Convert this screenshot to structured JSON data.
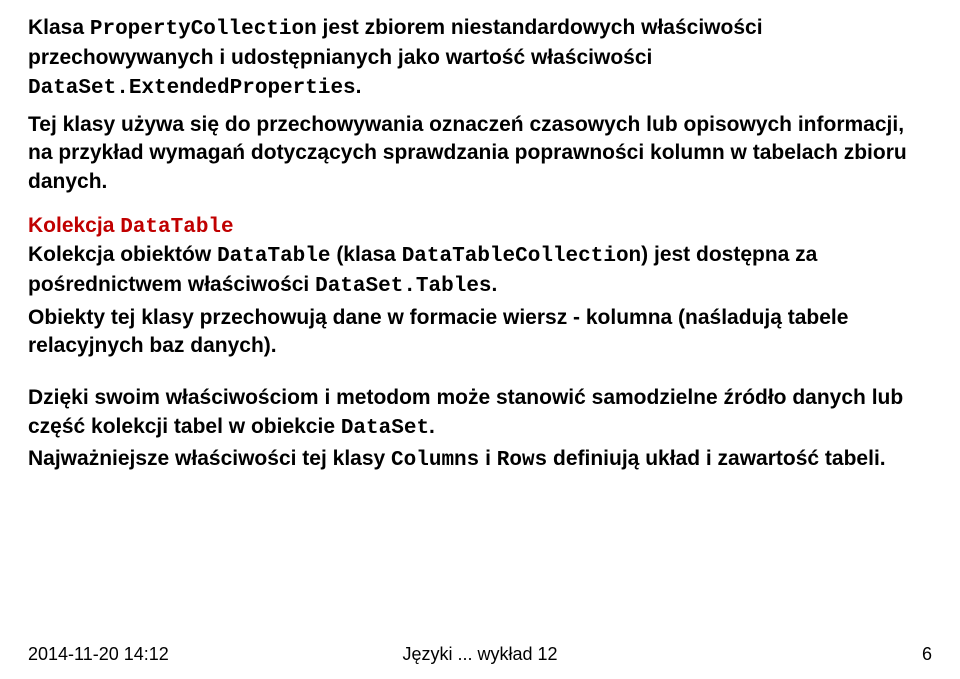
{
  "para1": {
    "pre1": "Klasa ",
    "code1": "PropertyCollection",
    "post1": " jest zbiorem niestandardowych właściwości przechowywanych i udostępnianych jako wartość właściwości ",
    "code2": "DataSet.ExtendedProperties",
    "post2": "."
  },
  "para2": "Tej klasy używa się do przechowywania oznaczeń czasowych lub opisowych informacji, na przykład wymagań dotyczących sprawdzania poprawności kolumn w tabelach zbioru danych.",
  "heading": {
    "pre": "Kolekcja ",
    "code": "DataTable"
  },
  "para3": {
    "pre1": "Kolekcja obiektów ",
    "code1": "DataTable",
    "mid1": " (klasa ",
    "code2": "DataTableCollection",
    "mid2": ") jest dostępna za pośrednictwem właściwości ",
    "code3": "DataSet.Tables",
    "post": "."
  },
  "para4": "Obiekty tej klasy przechowują dane w formacie wiersz - kolumna (naśladują tabele relacyjnych baz danych).",
  "para5": {
    "pre": "Dzięki swoim właściwościom i metodom może stanowić samodzielne źródło danych lub część kolekcji tabel w obiekcie ",
    "code": "DataSet",
    "post": "."
  },
  "para6": {
    "pre": "Najważniejsze właściwości tej klasy ",
    "code1": "Columns",
    "mid": " i ",
    "code2": "Rows",
    "post": "  definiują układ i zawartość tabeli."
  },
  "footer": {
    "left": "2014-11-20 14:12",
    "center": "Języki ... wykład 12",
    "right": "6"
  }
}
